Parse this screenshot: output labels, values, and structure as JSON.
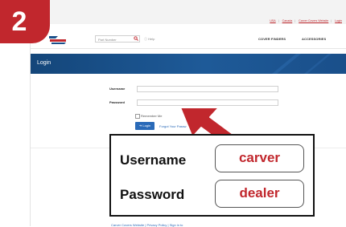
{
  "badge": {
    "number": "2"
  },
  "top_links": [
    "USA",
    "Canada",
    "Carver Covers Website",
    "Login"
  ],
  "header": {
    "search_placeholder": "Part Number",
    "help_label": "ⓘ Help",
    "nav": [
      "COVER FINDERS",
      "ACCESSORIES"
    ]
  },
  "banner": {
    "title": "Login"
  },
  "form": {
    "username_label": "Username",
    "password_label": "Password",
    "remember_label": "Remember Me",
    "login_button": "➔ Login",
    "forgot_link": "Forgot Your Passw"
  },
  "credentials": {
    "username_label": "Username",
    "username_value": "carver",
    "password_label": "Password",
    "password_value": "dealer"
  },
  "footer": {
    "text": "Carver Covers Website | Privacy Policy | Sign in to"
  },
  "colors": {
    "accent_red": "#c1272d",
    "banner_blue": "#1e5a98",
    "button_blue": "#2a6ab8"
  }
}
